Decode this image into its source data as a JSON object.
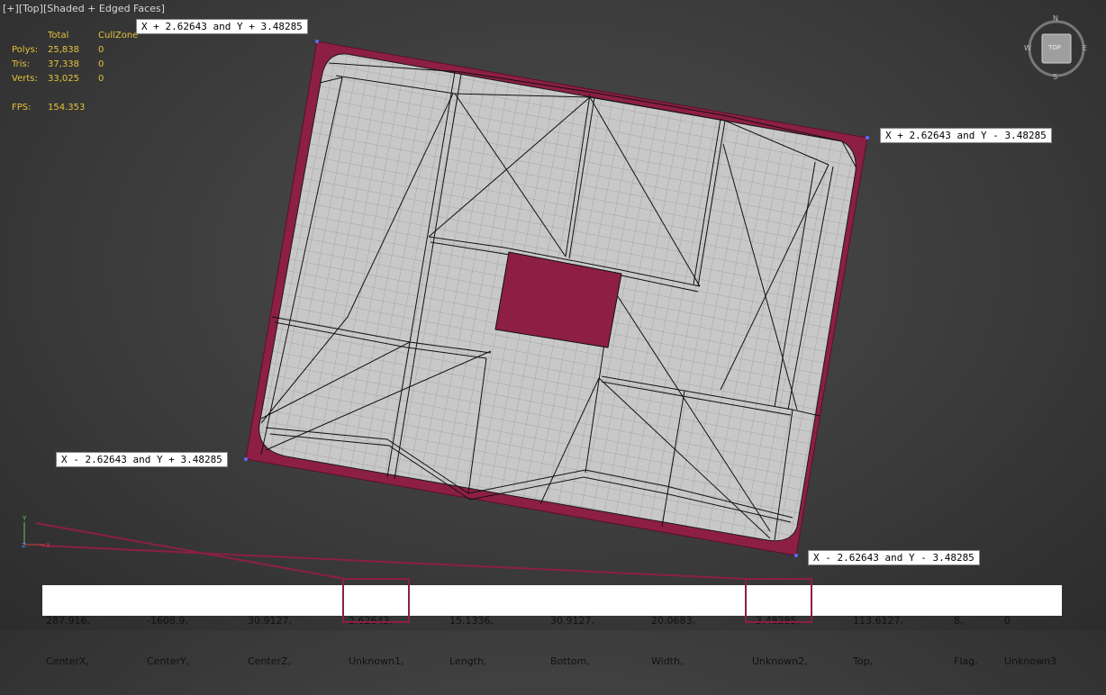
{
  "viewport": {
    "label_parts": [
      "[+]",
      "[Top]",
      "[Shaded + Edged Faces]"
    ]
  },
  "stats": {
    "headers": [
      "Total",
      "CullZone"
    ],
    "rows": [
      {
        "label": "Polys:",
        "total": "25,838",
        "cull": "0"
      },
      {
        "label": "Tris:",
        "total": "37,338",
        "cull": "0"
      },
      {
        "label": "Verts:",
        "total": "33,025",
        "cull": "0"
      }
    ],
    "fps_label": "FPS:",
    "fps_value": "154.353"
  },
  "callouts": {
    "top_left": "X + 2.62643 and Y + 3.48285",
    "top_right": "X + 2.62643 and Y - 3.48285",
    "bottom_left": "X - 2.62643 and Y + 3.48285",
    "bottom_right": "X - 2.62643 and Y - 3.48285"
  },
  "data_bar": {
    "columns": [
      {
        "value": "287.916,",
        "field": "CenterX,"
      },
      {
        "value": "-1608.9,",
        "field": "CenterY,"
      },
      {
        "value": "30.9127,",
        "field": "CenterZ,"
      },
      {
        "value": "2.62643,",
        "field": "Unknown1,"
      },
      {
        "value": "15.1336,",
        "field": "Length,"
      },
      {
        "value": "30.9127,",
        "field": "Bottom,"
      },
      {
        "value": "20.0683,",
        "field": "Width,"
      },
      {
        "value": "-3.48285,",
        "field": "Unknown2,"
      },
      {
        "value": "113.6127,",
        "field": "Top,"
      },
      {
        "value": "8,",
        "field": "Flag,"
      },
      {
        "value": "0",
        "field": "Unknown3"
      }
    ]
  },
  "viewcube": {
    "face_label": "TOP",
    "compass": [
      "N",
      "E",
      "S",
      "W"
    ]
  },
  "colors": {
    "accent": "#8d1f44",
    "mesh_fill": "#c6c6c6",
    "stats_text": "#e3c23a",
    "background": "#3f3f3f"
  }
}
